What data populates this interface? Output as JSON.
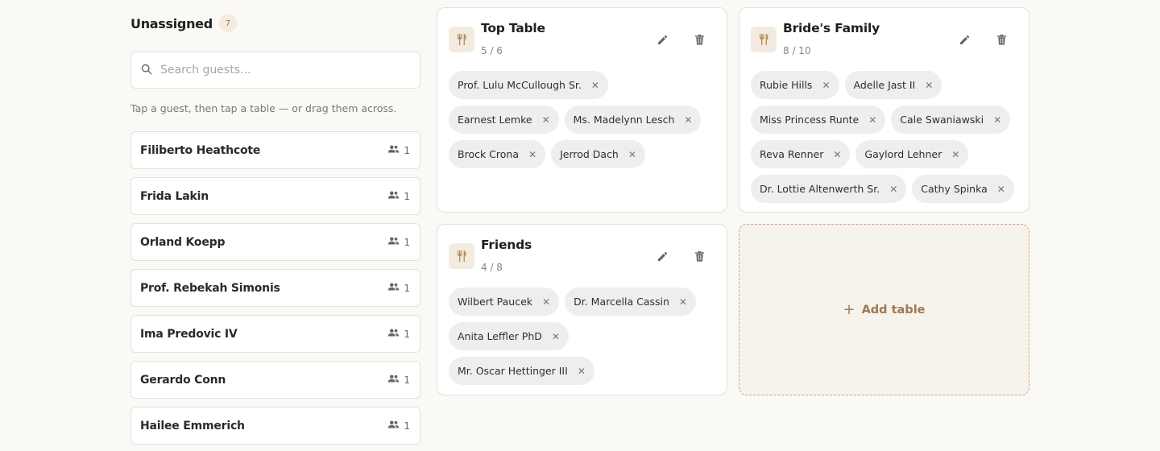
{
  "unassigned": {
    "title": "Unassigned",
    "count": "7",
    "search_placeholder": "Search guests...",
    "hint": "Tap a guest, then tap a table — or drag them across.",
    "guests": [
      {
        "name": "Filiberto Heathcote",
        "party": "1"
      },
      {
        "name": "Frida Lakin",
        "party": "1"
      },
      {
        "name": "Orland Koepp",
        "party": "1"
      },
      {
        "name": "Prof. Rebekah Simonis",
        "party": "1"
      },
      {
        "name": "Ima Predovic IV",
        "party": "1"
      },
      {
        "name": "Gerardo Conn",
        "party": "1"
      },
      {
        "name": "Hailee Emmerich",
        "party": "1"
      }
    ]
  },
  "tables": [
    {
      "name": "Top Table",
      "capacity": "5 / 6",
      "guests": [
        "Prof. Lulu McCullough Sr.",
        "Earnest Lemke",
        "Ms. Madelynn Lesch",
        "Brock Crona",
        "Jerrod Dach"
      ]
    },
    {
      "name": "Bride's Family",
      "capacity": "8 / 10",
      "guests": [
        "Rubie Hills",
        "Adelle Jast II",
        "Miss Princess Runte",
        "Cale Swaniawski",
        "Reva Renner",
        "Gaylord Lehner",
        "Dr. Lottie Altenwerth Sr.",
        "Cathy Spinka"
      ]
    },
    {
      "name": "Friends",
      "capacity": "4 / 8",
      "guests": [
        "Wilbert Paucek",
        "Dr. Marcella Cassin",
        "Anita Leffler PhD",
        "Mr. Oscar Hettinger III"
      ]
    }
  ],
  "add_table": {
    "label": "Add table",
    "icon": "plus-icon"
  },
  "icons": {
    "search": "search-icon",
    "party": "people-icon",
    "table": "utensils-icon",
    "edit": "pencil-icon",
    "delete": "trash-icon",
    "remove": "close-icon"
  },
  "colors": {
    "accent": "#9c7a52",
    "accent_bg": "#f3ebe0",
    "dashed_border": "#e0a27a"
  }
}
